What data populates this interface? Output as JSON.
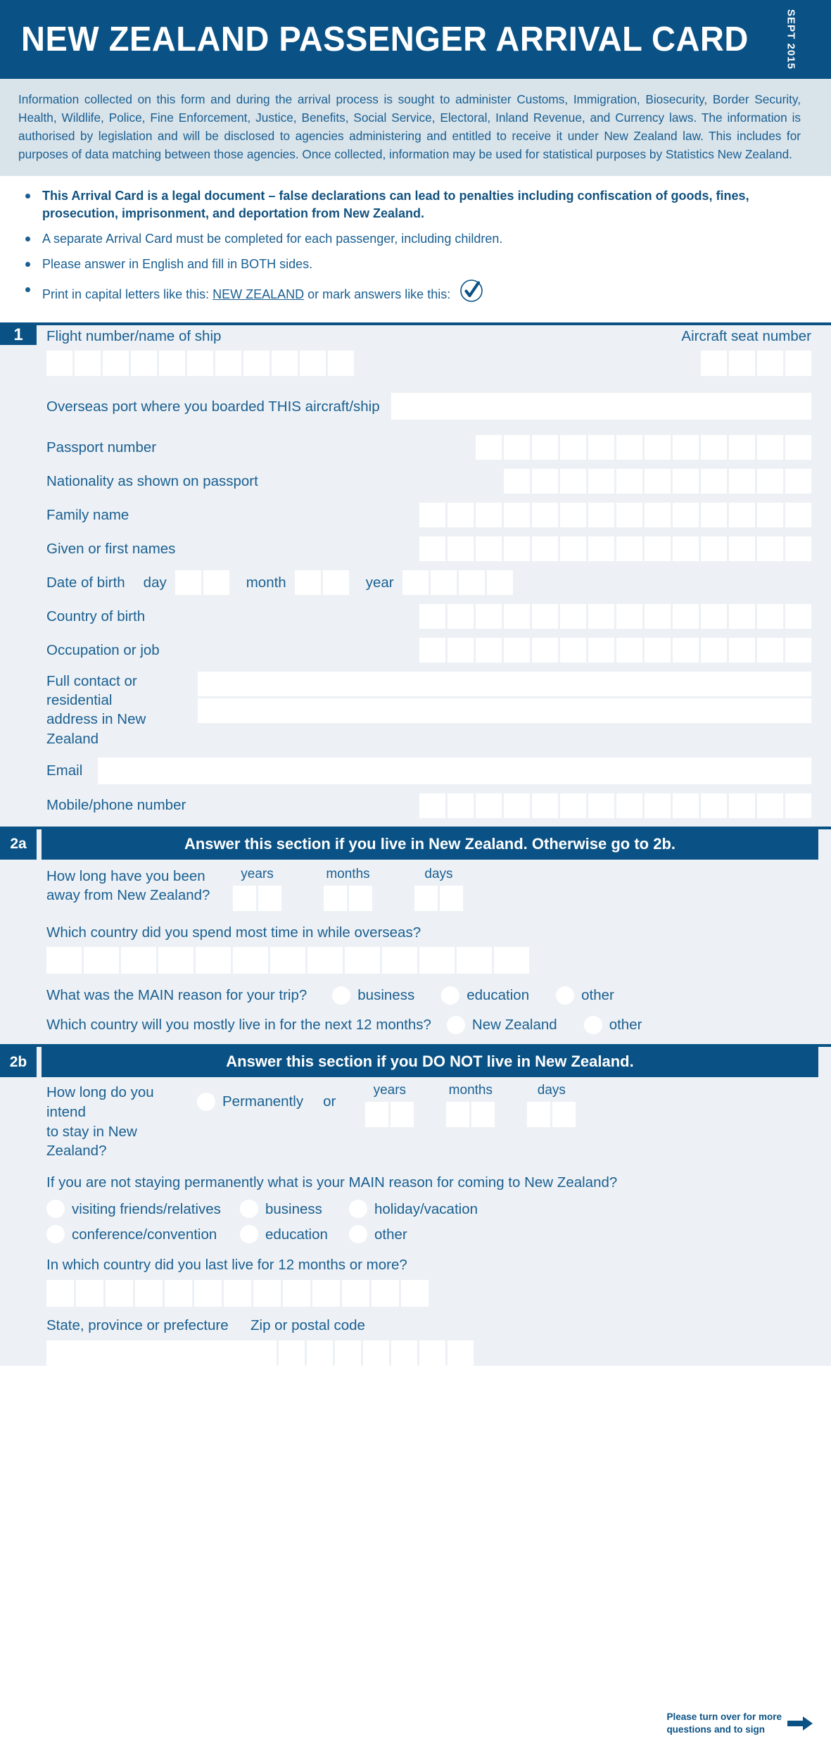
{
  "header": {
    "title": "NEW ZEALAND PASSENGER ARRIVAL CARD",
    "date": "SEPT 2015"
  },
  "info": {
    "paragraph": "Information collected on this form and during the arrival process is sought to administer Customs, Immigration, Biosecurity, Border Security, Health, Wildlife, Police, Fine Enforcement, Justice, Benefits, Social Service, Electoral, Inland Revenue, and Currency laws. The information is authorised by legislation and will be disclosed to agencies administering and entitled to receive it under New Zealand law. This includes for purposes of data matching between those agencies. Once collected, information may be used for statistical purposes by Statistics New Zealand."
  },
  "bullets": {
    "item1": "This Arrival Card is a legal document – false declarations can lead to penalties including confiscation of goods, fines, prosecution, imprisonment, and deportation from New Zealand.",
    "item2": "A separate Arrival Card must be completed for each passenger, including children.",
    "item3": "Please answer in English and fill in BOTH sides.",
    "item4_pre": "Print in capital letters like this:",
    "item4_example": "NEW ZEALAND",
    "item4_mid": "or mark answers like this:"
  },
  "section1": {
    "number": "1",
    "flight_label": "Flight number/name of ship",
    "flight_boxes": 11,
    "seat_label": "Aircraft seat number",
    "seat_boxes": 4,
    "port_label": "Overseas port where you boarded THIS aircraft/ship",
    "passport_label": "Passport number",
    "passport_boxes": 12,
    "nationality_label": "Nationality as shown on passport",
    "nationality_boxes": 11,
    "family_label": "Family name",
    "family_boxes": 14,
    "given_label": "Given or first names",
    "given_boxes": 14,
    "dob_label": "Date of birth",
    "dob_day_label": "day",
    "dob_day_boxes": 2,
    "dob_month_label": "month",
    "dob_month_boxes": 2,
    "dob_year_label": "year",
    "dob_year_boxes": 4,
    "country_birth_label": "Country of birth",
    "country_birth_boxes": 14,
    "occupation_label": "Occupation or job",
    "occupation_boxes": 14,
    "address_label_line1": "Full contact or residential",
    "address_label_line2": "address in New Zealand",
    "email_label": "Email",
    "mobile_label": "Mobile/phone number",
    "mobile_boxes": 14
  },
  "section2a": {
    "number": "2a",
    "title": "Answer this section if you live in New Zealand. Otherwise go to 2b.",
    "away_label_line1": "How long have you been",
    "away_label_line2": "away from New Zealand?",
    "years_label": "years",
    "months_label": "months",
    "days_label": "days",
    "years_boxes": 2,
    "months_boxes": 2,
    "days_boxes": 2,
    "most_time_label": "Which country did you spend most time in while overseas?",
    "most_time_boxes": 13,
    "main_reason_label": "What was the MAIN reason for your trip?",
    "main_reason_options": [
      "business",
      "education",
      "other"
    ],
    "next12_label": "Which country will you mostly live in for the next 12 months?",
    "next12_options": [
      "New Zealand",
      "other"
    ]
  },
  "section2b": {
    "number": "2b",
    "title": "Answer this section if you DO NOT live in New Zealand.",
    "stay_label_line1": "How long do you intend",
    "stay_label_line2": "to stay in New Zealand?",
    "permanently_label": "Permanently",
    "or_label": "or",
    "years_label": "years",
    "months_label": "months",
    "days_label": "days",
    "years_boxes": 2,
    "months_boxes": 2,
    "days_boxes": 2,
    "main_reason_label": "If you are not staying permanently what is your MAIN reason for coming to New Zealand?",
    "reason_options_row1": [
      "visiting friends/relatives",
      "business",
      "holiday/vacation"
    ],
    "reason_options_row2": [
      "conference/convention",
      "education",
      "other"
    ],
    "last_live_label": "In which country did you last live for 12 months or more?",
    "last_live_boxes": 13,
    "state_label": "State, province or prefecture",
    "zip_label": "Zip or postal code",
    "zip_boxes": 7
  },
  "footer": {
    "line1": "Please turn over for more",
    "line2": "questions and to sign"
  },
  "colors": {
    "brand_blue": "#0a5285",
    "text_blue": "#1a5f91",
    "info_bg": "#d8e3ea",
    "form_bg": "#edf1f5",
    "field_white": "#ffffff"
  }
}
